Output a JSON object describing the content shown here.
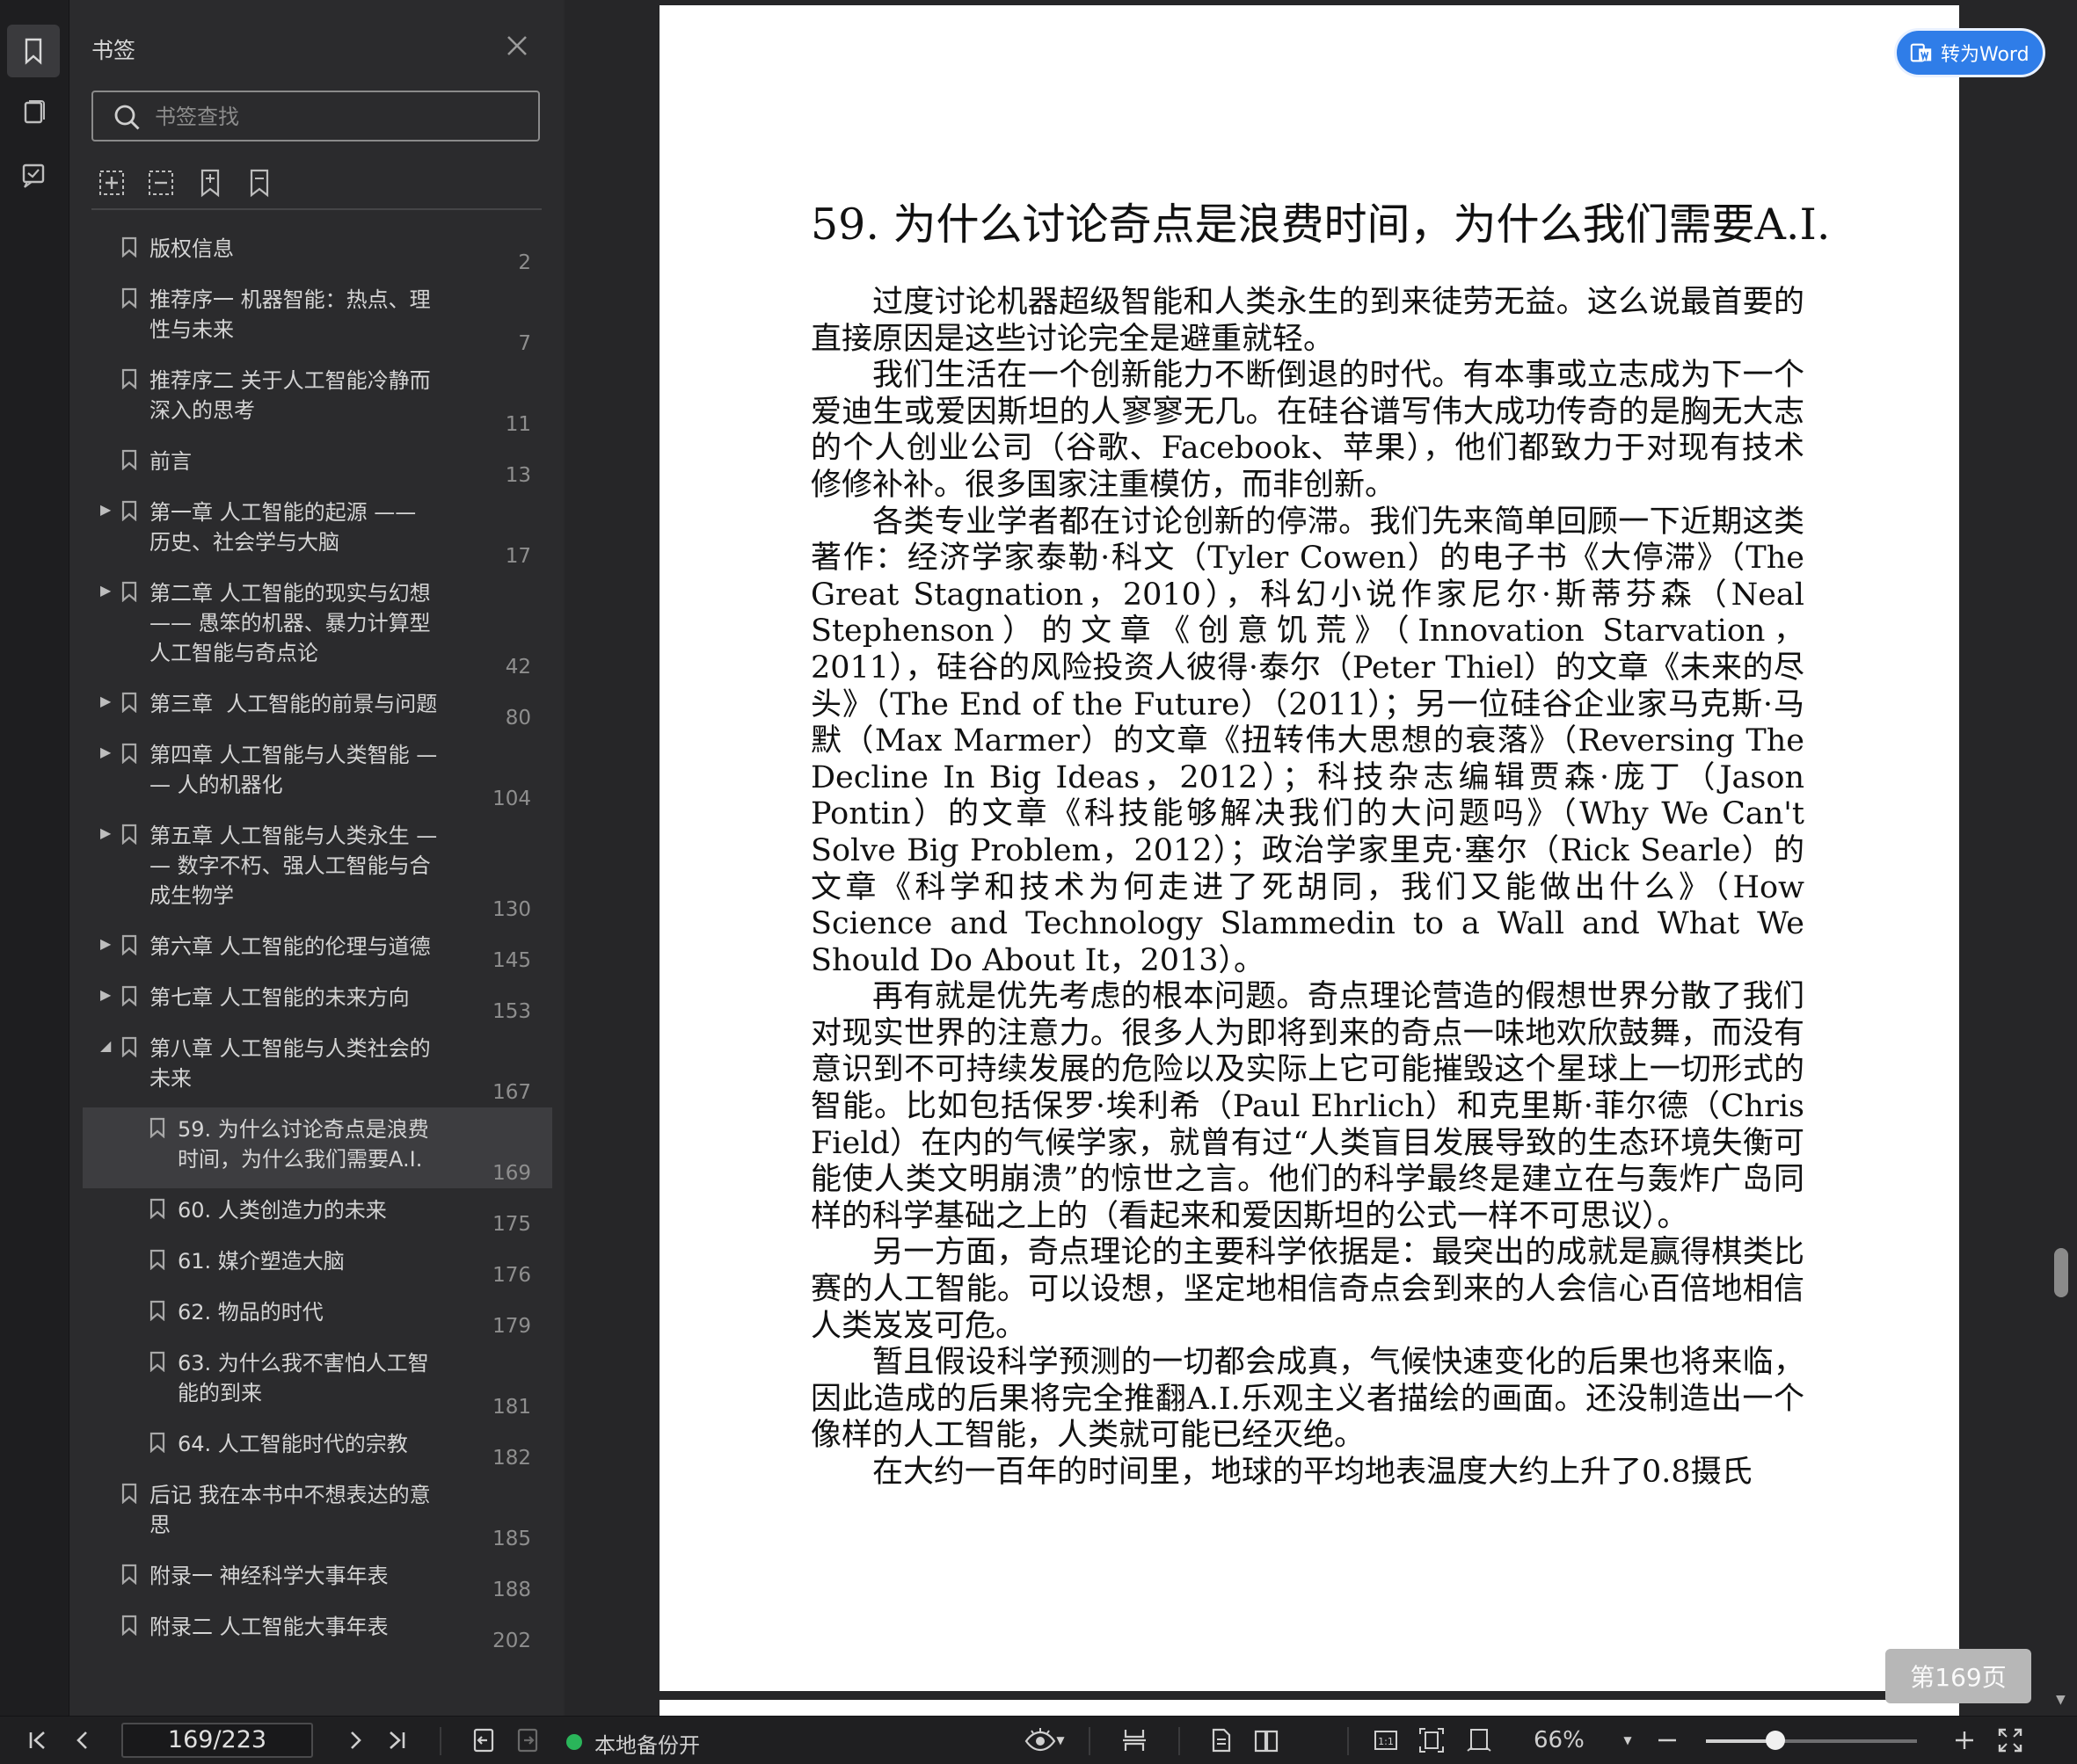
{
  "colors": {
    "accent": "#2f7de8",
    "selected_row": "#3d3d40",
    "backup_on": "#2ab55a"
  },
  "sidebar": {
    "title": "书签",
    "search_placeholder": "书签查找",
    "rail_icons": [
      "bookmark-icon",
      "thumbnail-icon",
      "annotation-icon"
    ],
    "tools": [
      "expand-all-icon",
      "collapse-all-icon",
      "add-bookmark-icon",
      "remove-bookmark-icon"
    ],
    "items": [
      {
        "label": "版权信息",
        "page": "2",
        "level": 0,
        "arrow": ""
      },
      {
        "label": "推荐序一 机器智能：热点、理\n性与未来",
        "page": "7",
        "level": 0,
        "arrow": ""
      },
      {
        "label": "推荐序二 关于人工智能冷静而\n深入的思考",
        "page": "11",
        "level": 0,
        "arrow": ""
      },
      {
        "label": "前言",
        "page": "13",
        "level": 0,
        "arrow": ""
      },
      {
        "label": "第一章 人工智能的起源 ——\n历史、社会学与大脑",
        "page": "17",
        "level": 0,
        "arrow": "▶"
      },
      {
        "label": "第二章 人工智能的现实与幻想\n—— 愚笨的机器、暴力计算型\n人工智能与奇点论",
        "page": "42",
        "level": 0,
        "arrow": "▶"
      },
      {
        "label": "第三章  人工智能的前景与问题",
        "page": "80",
        "level": 0,
        "arrow": "▶"
      },
      {
        "label": "第四章 人工智能与人类智能 —\n— 人的机器化",
        "page": "104",
        "level": 0,
        "arrow": "▶"
      },
      {
        "label": "第五章 人工智能与人类永生 —\n— 数字不朽、强人工智能与合\n成生物学",
        "page": "130",
        "level": 0,
        "arrow": "▶"
      },
      {
        "label": "第六章 人工智能的伦理与道德",
        "page": "145",
        "level": 0,
        "arrow": "▶"
      },
      {
        "label": "第七章 人工智能的未来方向",
        "page": "153",
        "level": 0,
        "arrow": "▶"
      },
      {
        "label": "第八章 人工智能与人类社会的\n未来",
        "page": "167",
        "level": 0,
        "arrow": "◢"
      },
      {
        "label": "59. 为什么讨论奇点是浪费\n时间，为什么我们需要A.I.",
        "page": "169",
        "level": 1,
        "arrow": "",
        "selected": true
      },
      {
        "label": "60. 人类创造力的未来",
        "page": "175",
        "level": 1,
        "arrow": ""
      },
      {
        "label": "61. 媒介塑造大脑",
        "page": "176",
        "level": 1,
        "arrow": ""
      },
      {
        "label": "62. 物品的时代",
        "page": "179",
        "level": 1,
        "arrow": ""
      },
      {
        "label": "63. 为什么我不害怕人工智\n能的到来",
        "page": "181",
        "level": 1,
        "arrow": ""
      },
      {
        "label": "64. 人工智能时代的宗教",
        "page": "182",
        "level": 1,
        "arrow": ""
      },
      {
        "label": "后记 我在本书中不想表达的意\n思",
        "page": "185",
        "level": 0,
        "arrow": ""
      },
      {
        "label": "附录一 神经科学大事年表",
        "page": "188",
        "level": 0,
        "arrow": ""
      },
      {
        "label": "附录二 人工智能大事年表",
        "page": "202",
        "level": 0,
        "arrow": ""
      }
    ]
  },
  "document": {
    "chapter_title": "59. 为什么讨论奇点是浪费时间，为什么我们需要A.I.",
    "paragraphs": [
      "过度讨论机器超级智能和人类永生的到来徒劳无益。这么说最首要的直接原因是这些讨论完全是避重就轻。",
      "我们生活在一个创新能力不断倒退的时代。有本事或立志成为下一个爱迪生或爱因斯坦的人寥寥无几。在硅谷谱写伟大成功传奇的是胸无大志的个人创业公司（谷歌、Facebook、苹果），他们都致力于对现有技术修修补补。很多国家注重模仿，而非创新。",
      "各类专业学者都在讨论创新的停滞。我们先来简单回顾一下近期这类著作：经济学家泰勒·科文（Tyler Cowen）的电子书《大停滞》（The Great Stagnation，2010），科幻小说作家尼尔·斯蒂芬森（Neal Stephenson）的文章《创意饥荒》（Innovation Starvation，2011），硅谷的风险投资人彼得·泰尔（Peter Thiel）的文章《未来的尽头》（The End of the Future）（2011）；另一位硅谷企业家马克斯·马默（Max Marmer）的文章《扭转伟大思想的衰落》（Reversing The Decline In Big Ideas，2012）；科技杂志编辑贾森·庞丁（Jason Pontin）的文章《科技能够解决我们的大问题吗》（Why We Can't Solve Big Problem，2012）；政治学家里克·塞尔（Rick Searle）的文章《科学和技术为何走进了死胡同，我们又能做出什么》（How Science and Technology Slammedin to a Wall and What We Should Do About It，2013）。",
      "再有就是优先考虑的根本问题。奇点理论营造的假想世界分散了我们对现实世界的注意力。很多人为即将到来的奇点一味地欢欣鼓舞，而没有意识到不可持续发展的危险以及实际上它可能摧毁这个星球上一切形式的智能。比如包括保罗·埃利希（Paul Ehrlich）和克里斯·菲尔德（Chris Field）在内的气候学家，就曾有过“人类盲目发展导致的生态环境失衡可能使人类文明崩溃”的惊世之言。他们的科学最终是建立在与轰炸广岛同样的科学基础之上的（看起来和爱因斯坦的公式一样不可思议）。",
      "另一方面，奇点理论的主要科学依据是：最突出的成就是赢得棋类比赛的人工智能。可以设想，坚定地相信奇点会到来的人会信心百倍地相信人类岌岌可危。",
      "暂且假设科学预测的一切都会成真，气候快速变化的后果也将来临，因此造成的后果将完全推翻A.I.乐观主义者描绘的画面。还没制造出一个像样的人工智能，人类就可能已经灭绝。",
      "在大约一百年的时间里，地球的平均地表温度大约上升了0.8摄氏"
    ],
    "convert_button": "转为Word",
    "page_badge": "第169页"
  },
  "statusbar": {
    "page_field": "169/223",
    "backup_text": "本地备份开",
    "zoom": "66%",
    "zoom_fraction": 0.33
  }
}
